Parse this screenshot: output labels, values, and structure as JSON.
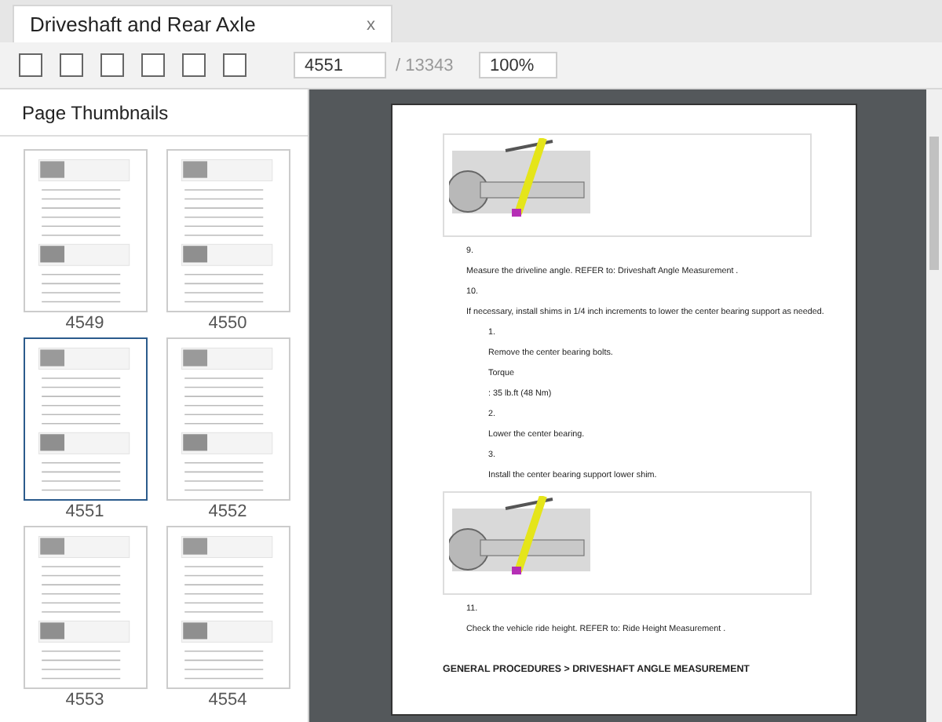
{
  "tab": {
    "title": "Driveshaft and Rear Axle",
    "close": "x"
  },
  "toolbar": {
    "page_value": "4551",
    "page_total": "/ 13343",
    "zoom_value": "100%"
  },
  "sidebar": {
    "title": "Page Thumbnails",
    "thumbnails": [
      {
        "page": "4549",
        "selected": false
      },
      {
        "page": "4550",
        "selected": false
      },
      {
        "page": "4551",
        "selected": true
      },
      {
        "page": "4552",
        "selected": false
      },
      {
        "page": "4553",
        "selected": false
      },
      {
        "page": "4554",
        "selected": false
      }
    ]
  },
  "document": {
    "blocks": [
      {
        "kind": "figure"
      },
      {
        "kind": "step_number",
        "text": "9."
      },
      {
        "kind": "step_text",
        "text": "Measure the driveline angle. REFER to: Driveshaft Angle Measurement ."
      },
      {
        "kind": "step_number",
        "text": "10."
      },
      {
        "kind": "step_text",
        "text": "If necessary, install shims in 1/4 inch increments to lower the center bearing support as needed."
      },
      {
        "kind": "sub_number",
        "text": "1."
      },
      {
        "kind": "sub_text",
        "text": "Remove the center bearing bolts."
      },
      {
        "kind": "sub_text",
        "text": "Torque"
      },
      {
        "kind": "sub_text",
        "text": ": 35 lb.ft (48 Nm)"
      },
      {
        "kind": "sub_number",
        "text": "2."
      },
      {
        "kind": "sub_text",
        "text": "Lower the center bearing."
      },
      {
        "kind": "sub_number",
        "text": "3."
      },
      {
        "kind": "sub_text",
        "text": "Install the center bearing support lower shim."
      },
      {
        "kind": "figure"
      },
      {
        "kind": "step_number",
        "text": "11."
      },
      {
        "kind": "step_text",
        "text": "Check the vehicle ride height. REFER to: Ride Height Measurement ."
      },
      {
        "kind": "heading",
        "text": "GENERAL PROCEDURES > DRIVESHAFT ANGLE MEASUREMENT"
      }
    ]
  }
}
